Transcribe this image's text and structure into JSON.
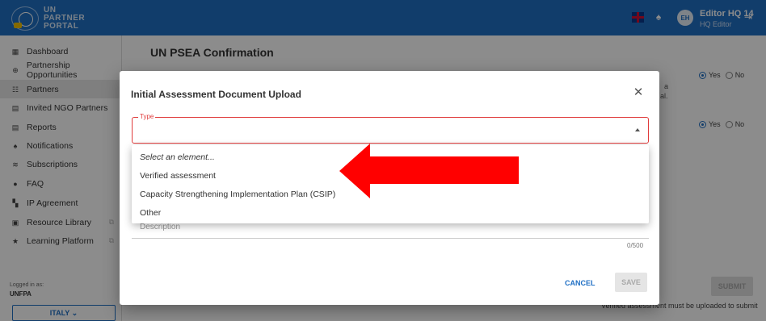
{
  "topbar": {
    "logo_lines": [
      "UN",
      "PARTNER",
      "PORTAL"
    ],
    "avatar_initials": "EH",
    "user_name": "Editor HQ 14",
    "user_role": "HQ Editor"
  },
  "sidebar": {
    "items": [
      {
        "label": "Dashboard",
        "icon": "dashboard-icon",
        "glyph": "▦"
      },
      {
        "label": "Partnership Opportunities",
        "icon": "globe-icon",
        "glyph": "⊕"
      },
      {
        "label": "Partners",
        "icon": "people-icon",
        "glyph": "☷"
      },
      {
        "label": "Invited NGO Partners",
        "icon": "invite-icon",
        "glyph": "▤"
      },
      {
        "label": "Reports",
        "icon": "report-icon",
        "glyph": "▤"
      },
      {
        "label": "Notifications",
        "icon": "bell-icon",
        "glyph": "♠"
      },
      {
        "label": "Subscriptions",
        "icon": "rss-icon",
        "glyph": "≋"
      },
      {
        "label": "FAQ",
        "icon": "help-icon",
        "glyph": "●"
      },
      {
        "label": "IP Agreement",
        "icon": "agreement-icon",
        "glyph": "▚"
      },
      {
        "label": "Resource Library",
        "icon": "library-icon",
        "glyph": "▣"
      },
      {
        "label": "Learning Platform",
        "icon": "star-icon",
        "glyph": "★"
      }
    ],
    "logged_label": "Logged in as:",
    "logged_value": "UNFPA",
    "country": "ITALY ⌄"
  },
  "main": {
    "title": "UN PSEA Confirmation",
    "bg_fragment_a": "a",
    "bg_fragment_b": "al.",
    "yes_label": "Yes",
    "no_label": "No",
    "submit": "SUBMIT",
    "note": "Verified assessment must be uploaded to submit"
  },
  "modal": {
    "title": "Initial Assessment Document Upload",
    "type_label": "Type",
    "description_placeholder": "Description",
    "counter": "0/500",
    "cancel": "CANCEL",
    "save": "SAVE"
  },
  "menu": {
    "options": [
      "Select an element...",
      "Verified assessment",
      "Capacity Strengthening Implementation Plan (CSIP)",
      "Other"
    ]
  },
  "colors": {
    "brand_blue": "#1f6fc4",
    "error_red": "#e03b3b",
    "annotation_arrow": "#ff0000"
  }
}
